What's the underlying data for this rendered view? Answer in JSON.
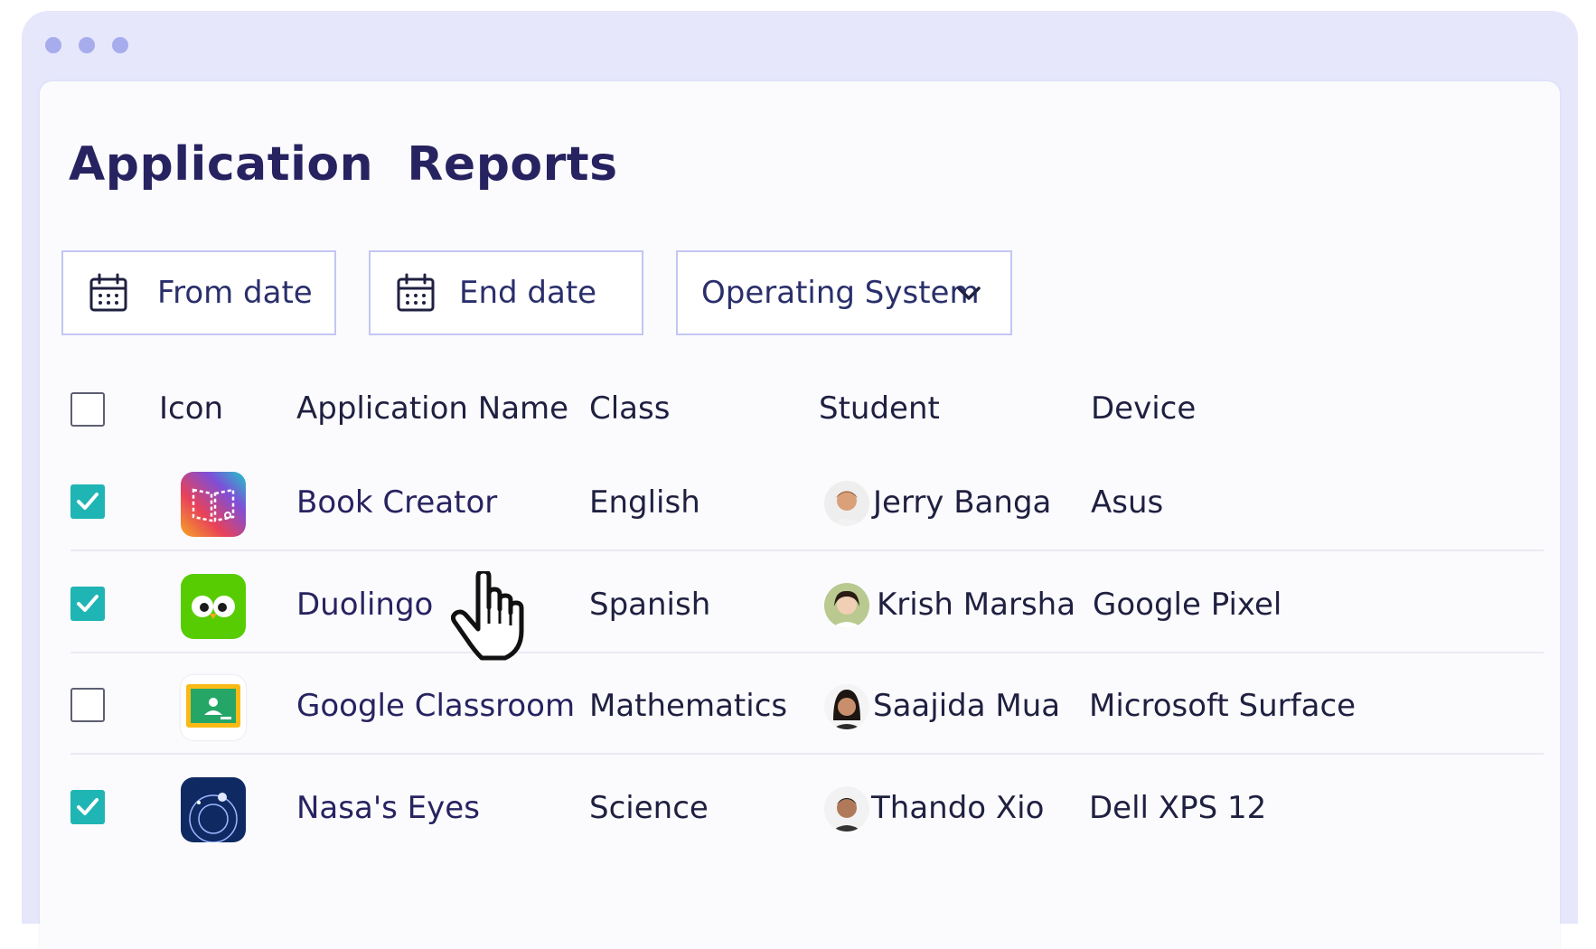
{
  "window": {
    "dots": [
      "#a6acec",
      "#a6acec",
      "#a6acec"
    ]
  },
  "page": {
    "title": "Application  Reports"
  },
  "filters": {
    "from_date": {
      "label": "From date",
      "icon": "calendar-icon"
    },
    "end_date": {
      "label": "End date",
      "icon": "calendar-icon"
    },
    "os": {
      "label": "Operating System",
      "icon": "chevron-down-icon"
    }
  },
  "table": {
    "columns": {
      "icon": "Icon",
      "app": "Application Name",
      "class": "Class",
      "student": "Student",
      "device": "Device"
    },
    "select_all_checked": false,
    "rows": [
      {
        "checked": true,
        "icon": "book-creator-icon",
        "app": "Book Creator",
        "class": "English",
        "student": "Jerry Banga",
        "device": "Asus"
      },
      {
        "checked": true,
        "icon": "duolingo-icon",
        "app": "Duolingo",
        "class": "Spanish",
        "student": "Krish Marsha",
        "device": "Google Pixel"
      },
      {
        "checked": false,
        "icon": "google-classroom-icon",
        "app": "Google Classroom",
        "class": "Mathematics",
        "student": "Saajida Mua",
        "device": "Microsoft Surface"
      },
      {
        "checked": true,
        "icon": "nasas-eyes-icon",
        "app": "Nasa's Eyes",
        "class": "Science",
        "student": "Thando Xio",
        "device": "Dell XPS 12"
      }
    ]
  },
  "colors": {
    "accent_checkbox": "#1fb5b4",
    "title": "#272360",
    "window_bg": "#e6e7fb",
    "filter_border": "#c3c6f2"
  }
}
